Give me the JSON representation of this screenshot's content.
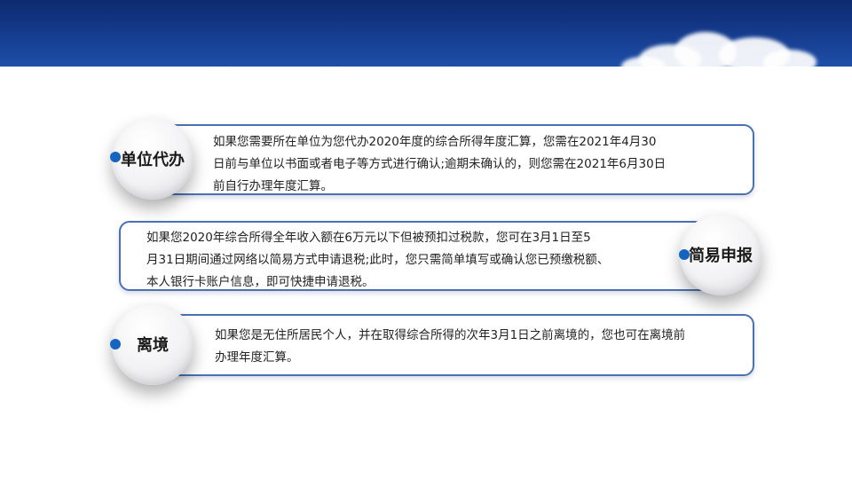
{
  "items": [
    {
      "label": "单位代办",
      "lines": [
        "如果您需要所在单位为您代办2020年度的综合所得年度汇算，您需在2021年4月30",
        "日前与单位以书面或者电子等方式进行确认;逾期未确认的，则您需在2021年6月30日",
        "前自行办理年度汇算。"
      ]
    },
    {
      "label": "简易申报",
      "lines": [
        "如果您2020年综合所得全年收入额在6万元以下但被预扣过税款，您可在3月1日至5",
        "月31日期间通过网络以简易方式申请退税;此时，您只需简单填写或确认您已预缴税额、",
        "本人银行卡账户信息，即可快捷申请退税。"
      ]
    },
    {
      "label": "离境",
      "lines": [
        "如果您是无住所居民个人，并在取得综合所得的次年3月1日之前离境的，您也可在离境前",
        "办理年度汇算。"
      ]
    }
  ],
  "colors": {
    "banner": "#163d8f",
    "border": "#4a72b3",
    "dot": "#1565c0"
  }
}
